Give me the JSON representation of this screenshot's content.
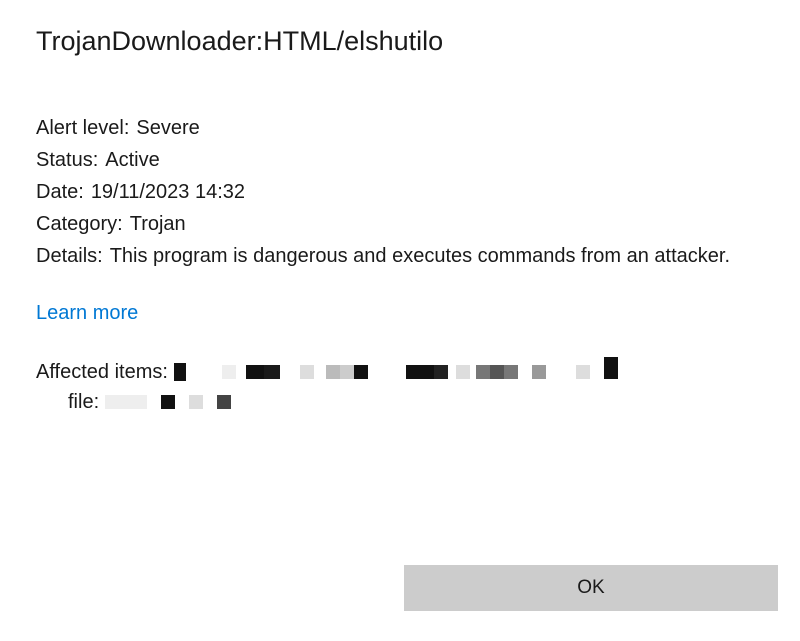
{
  "dialog": {
    "title": "TrojanDownloader:HTML/elshutilo"
  },
  "info": {
    "alert_level_label": "Alert level:",
    "alert_level_value": "Severe",
    "status_label": "Status:",
    "status_value": "Active",
    "date_label": "Date:",
    "date_value": "19/11/2023 14:32",
    "category_label": "Category:",
    "category_value": "Trojan",
    "details_label": "Details:",
    "details_value": "This program is dangerous and executes commands from an attacker."
  },
  "link": {
    "learn_more": "Learn more"
  },
  "affected": {
    "label": "Affected items:",
    "file_label": "file:"
  },
  "buttons": {
    "ok": "OK"
  }
}
